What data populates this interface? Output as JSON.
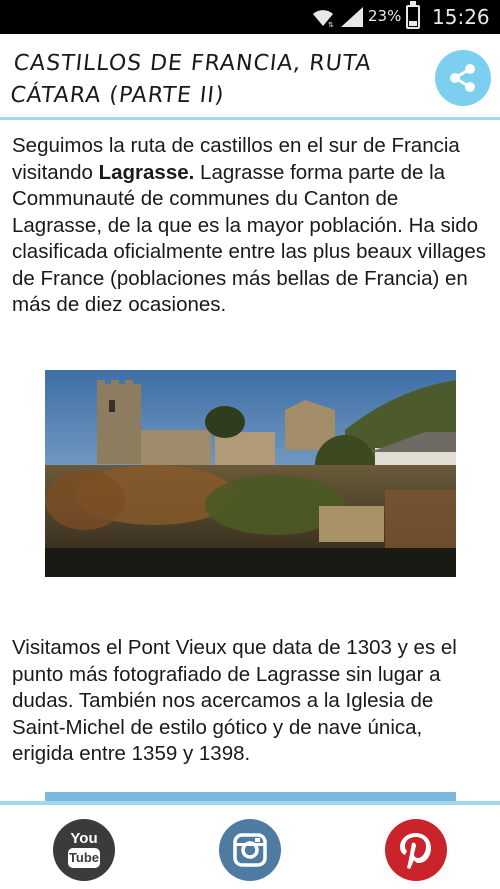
{
  "status_bar": {
    "battery_percent": "23%",
    "battery_level": 0.23,
    "time": "15:26",
    "icons": [
      "wifi-icon",
      "signal-icon",
      "battery-icon"
    ]
  },
  "header": {
    "title": "CASTILLOS DE FRANCIA, RUTA CÁTARA (PARTE II)",
    "share_icon": "share-icon"
  },
  "article": {
    "para1_pre": "Seguimos la ruta de castillos en el sur de Francia visitando ",
    "para1_bold": "Lagrasse.",
    "para1_post": " Lagrasse forma parte de la Communauté de communes du Canton de Lagrasse, de la que es la mayor población. Ha sido clasificada oficialmente entre las plus beaux villages de France (poblaciones más bellas de Francia) en más de diez ocasiones.",
    "para2": "Visitamos el Pont Vieux que data de 1303 y es el punto más fotografiado de Lagrasse sin lugar a dudas. También nos acercamos a la Iglesia de Saint-Michel de estilo gótico y de nave única, erigida entre 1359 y 1398."
  },
  "bottom_bar": {
    "youtube_you": "You",
    "youtube_tube": "Tube",
    "icons": [
      "youtube-icon",
      "instagram-icon",
      "pinterest-icon"
    ]
  },
  "colors": {
    "accent": "#9fd8ec",
    "share": "#7ccfef",
    "youtube": "#3b3b3b",
    "instagram": "#4f7ba3",
    "pinterest": "#c9232b"
  }
}
